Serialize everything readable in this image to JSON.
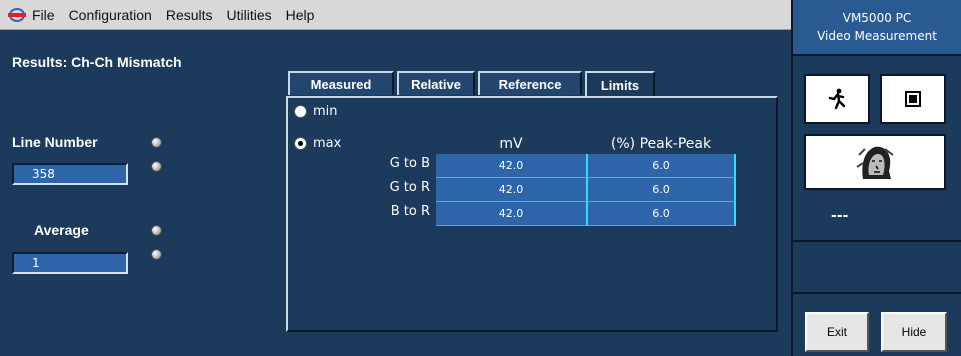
{
  "menubar": {
    "items": [
      "File",
      "Configuration",
      "Results",
      "Utilities",
      "Help"
    ]
  },
  "left": {
    "title": "Results: Ch-Ch Mismatch",
    "line_number_label": "Line Number",
    "line_number_value": "358",
    "average_label": "Average",
    "average_value": "1"
  },
  "tabs": [
    "Measured",
    "Relative",
    "Reference",
    "Limits"
  ],
  "active_tab": "Limits",
  "limits": {
    "radio_min": "min",
    "radio_max": "max",
    "selected": "max",
    "col_mv": "mV",
    "col_pct": "(%) Peak-Peak",
    "rows": [
      {
        "label": "G to B",
        "mv": "42.0",
        "pct": "6.0"
      },
      {
        "label": "G to R",
        "mv": "42.0",
        "pct": "6.0"
      },
      {
        "label": "B to R",
        "mv": "42.0",
        "pct": "6.0"
      }
    ]
  },
  "right_panel": {
    "title_line1": "VM5000 PC",
    "title_line2": "Video Measurement",
    "status": "---",
    "exit_label": "Exit",
    "hide_label": "Hide"
  },
  "icons": {
    "run": "running-man-icon",
    "stop": "stop-square-icon",
    "app": "tektronix-logo-icon",
    "image": "face-image-icon"
  }
}
